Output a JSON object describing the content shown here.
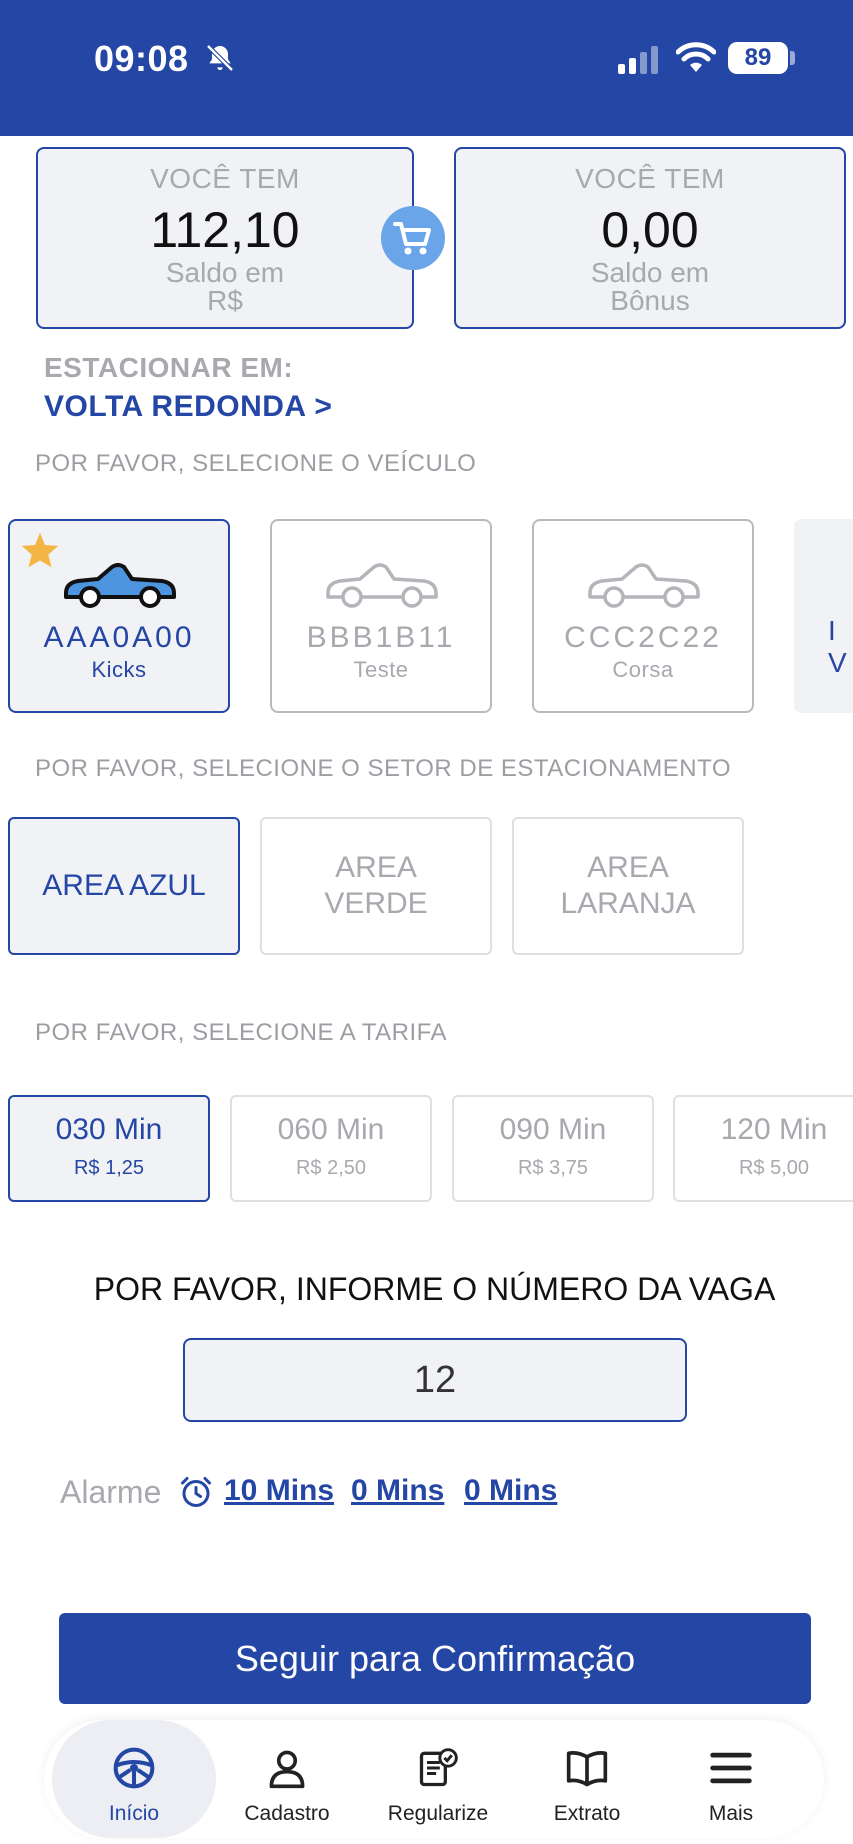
{
  "status_bar": {
    "time": "09:08",
    "battery": "89"
  },
  "balance": {
    "left": {
      "header": "VOCÊ TEM",
      "value": "112,10",
      "caption_line1": "Saldo em",
      "caption_line2": "R$"
    },
    "right": {
      "header": "VOCÊ TEM",
      "value": "0,00",
      "caption_line1": "Saldo em",
      "caption_line2": "Bônus"
    }
  },
  "location": {
    "label": "ESTACIONAR EM:",
    "city": "VOLTA REDONDA >"
  },
  "vehicles": {
    "title": "POR FAVOR, SELECIONE O VEÍCULO",
    "items": [
      {
        "plate": "AAA0A00",
        "model": "Kicks"
      },
      {
        "plate": "BBB1B11",
        "model": "Teste"
      },
      {
        "plate": "CCC2C22",
        "model": "Corsa"
      }
    ],
    "peek_line1": "I",
    "peek_line2": "V"
  },
  "sectors": {
    "title": "POR FAVOR, SELECIONE O SETOR DE ESTACIONAMENTO",
    "items": [
      "AREA AZUL",
      "AREA VERDE",
      "AREA LARANJA"
    ]
  },
  "tariffs": {
    "title": "POR FAVOR, SELECIONE A TARIFA",
    "items": [
      {
        "minutes": "030 Min",
        "price": "R$ 1,25"
      },
      {
        "minutes": "060 Min",
        "price": "R$ 2,50"
      },
      {
        "minutes": "090 Min",
        "price": "R$ 3,75"
      },
      {
        "minutes": "120 Min",
        "price": "R$ 5,00"
      }
    ]
  },
  "spot": {
    "title": "POR FAVOR, INFORME O NÚMERO DA VAGA",
    "value": "12"
  },
  "alarm": {
    "label": "Alarme",
    "options": [
      "10 Mins",
      "0 Mins",
      "0 Mins"
    ]
  },
  "cta": {
    "label": "Seguir para Confirmação"
  },
  "nav": {
    "items": [
      {
        "label": "Início",
        "icon": "steering-wheel-icon"
      },
      {
        "label": "Cadastro",
        "icon": "user-icon"
      },
      {
        "label": "Regularize",
        "icon": "document-check-icon"
      },
      {
        "label": "Extrato",
        "icon": "book-icon"
      },
      {
        "label": "Mais",
        "icon": "menu-icon"
      }
    ]
  },
  "colors": {
    "primary": "#2446a5",
    "cart_bubble": "#6aa5ea",
    "star": "#f5b544",
    "muted_text": "#a7a9ae"
  }
}
